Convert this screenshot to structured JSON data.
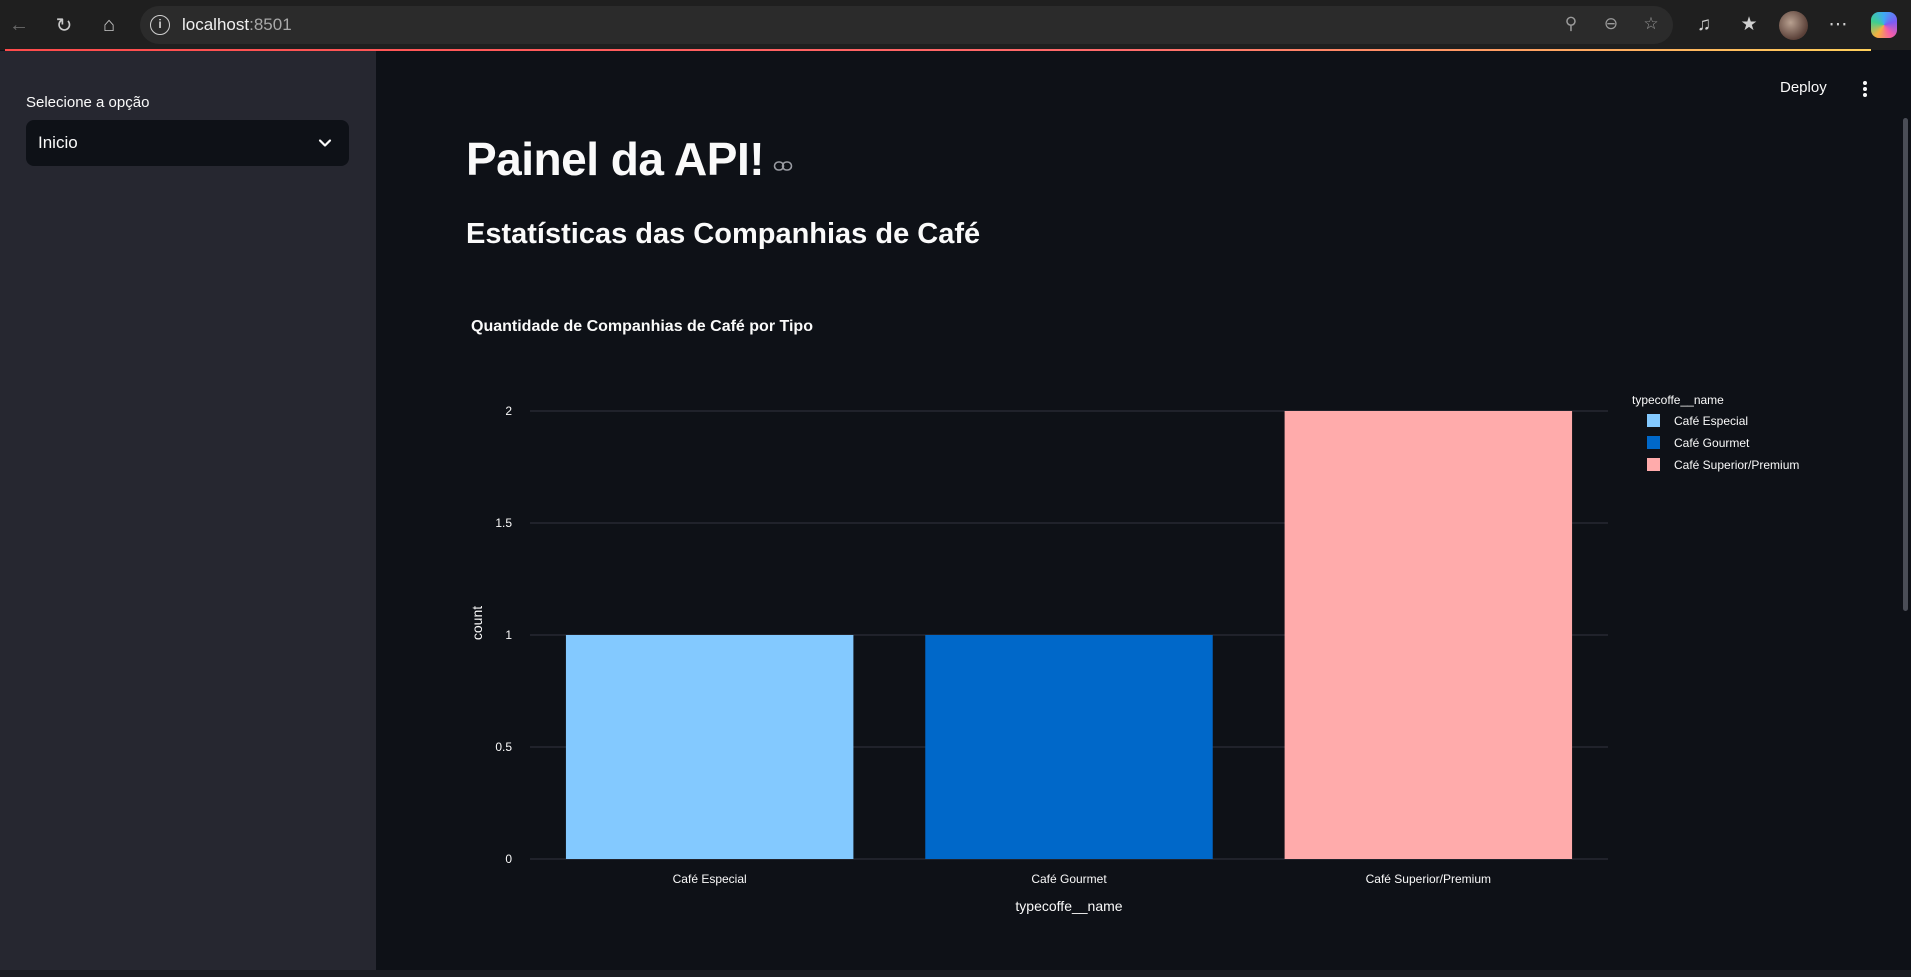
{
  "browser": {
    "url_host": "localhost",
    "url_port": ":8501"
  },
  "sidebar": {
    "label": "Selecione a opção",
    "select_value": "Inicio"
  },
  "header": {
    "deploy_label": "Deploy"
  },
  "main": {
    "title": "Painel da API!",
    "subtitle": "Estatísticas das Companhias de Café"
  },
  "chart_data": {
    "type": "bar",
    "title": "Quantidade de Companhias de Café por Tipo",
    "xlabel": "typecoffe__name",
    "ylabel": "count",
    "categories": [
      "Café Especial",
      "Café Gourmet",
      "Café Superior/Premium"
    ],
    "values": [
      1,
      1,
      2
    ],
    "colors": [
      "#83c9ff",
      "#0068c9",
      "#ffabab"
    ],
    "ylim": [
      0,
      2
    ],
    "yticks": [
      0,
      0.5,
      1,
      1.5,
      2
    ],
    "ytick_labels": [
      "0",
      "0.5",
      "1",
      "1.5",
      "2"
    ],
    "legend_title": "typecoffe__name",
    "legend_position": "top-right",
    "grid": true
  },
  "colors": {
    "bg": "#0e1117",
    "sidebar": "#262730",
    "accent": "#ff4b4b"
  }
}
